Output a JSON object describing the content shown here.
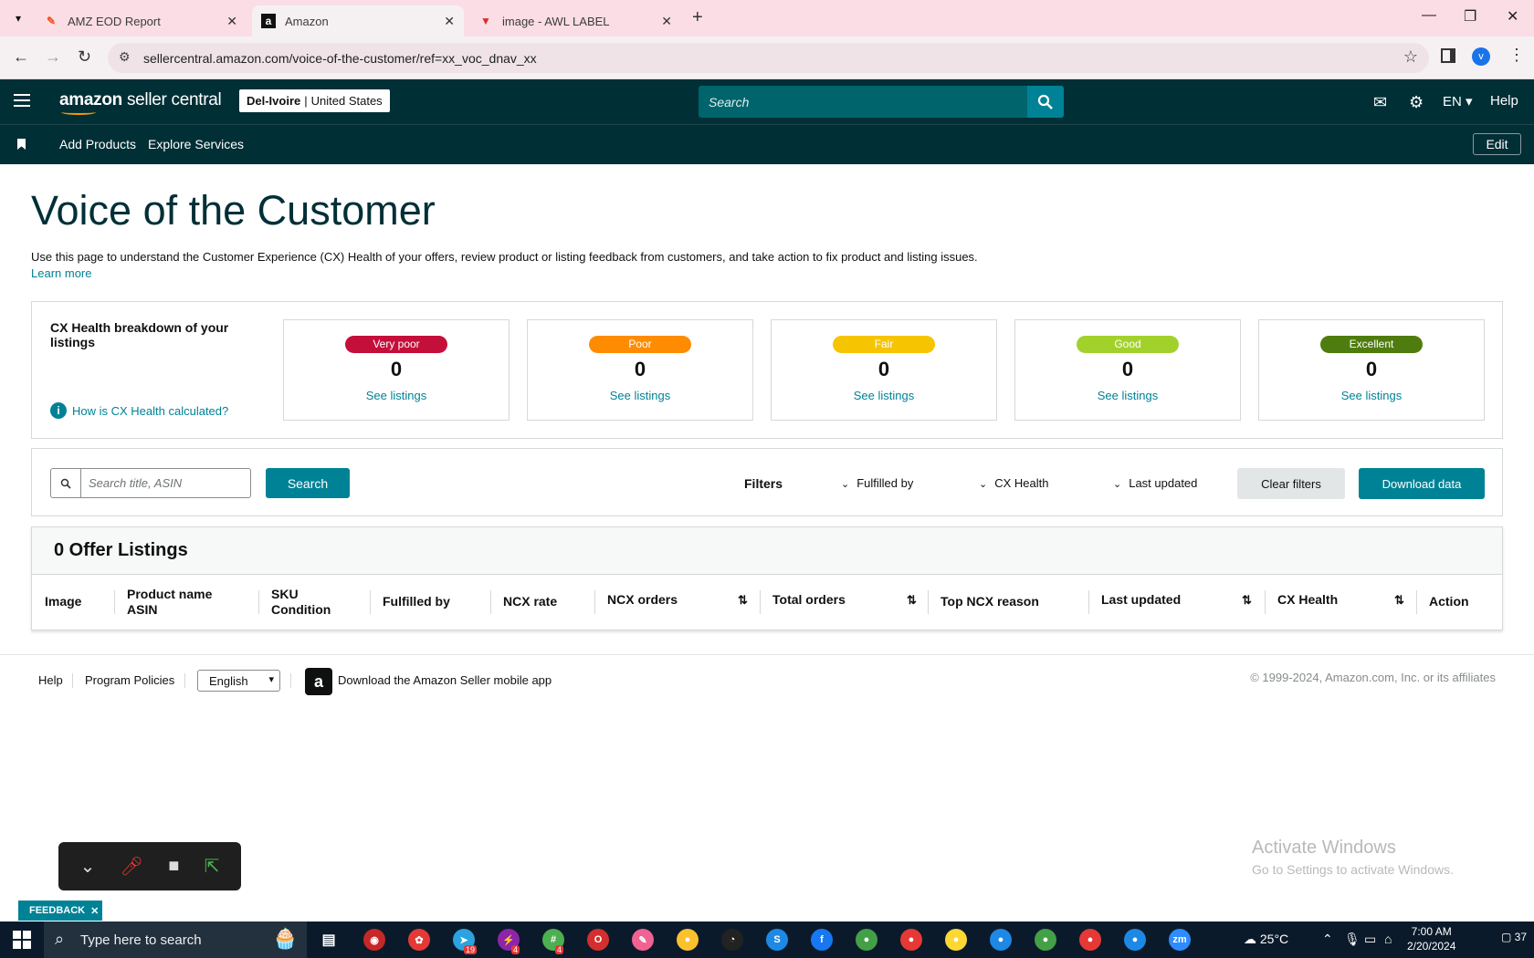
{
  "browser": {
    "tabs": [
      {
        "title": "AMZ EOD Report",
        "favicon": "apps-script-icon"
      },
      {
        "title": "Amazon",
        "favicon": "amazon-icon"
      },
      {
        "title": "image - AWL LABEL",
        "favicon": "image-icon"
      }
    ],
    "url": "sellercentral.amazon.com/voice-of-the-customer/ref=xx_voc_dnav_xx",
    "profile_initial": "v"
  },
  "header": {
    "logo_main": "amazon",
    "logo_suffix": "seller central",
    "store_name": "Del-Ivoire",
    "store_region": "United States",
    "search_placeholder": "Search",
    "language": "EN",
    "help": "Help"
  },
  "nav": {
    "links": [
      "Add Products",
      "Explore Services"
    ],
    "edit": "Edit"
  },
  "page": {
    "title": "Voice of the Customer",
    "intro": "Use this page to understand the Customer Experience (CX) Health of your offers, review product or listing feedback from customers, and take action to fix product and listing issues.",
    "learn_more": "Learn more"
  },
  "cx_health": {
    "title": "CX Health breakdown of your listings",
    "how_link": "How is CX Health calculated?",
    "cards": [
      {
        "label": "Very poor",
        "count": "0",
        "link": "See listings",
        "color": "#c40f3a"
      },
      {
        "label": "Poor",
        "count": "0",
        "link": "See listings",
        "color": "#ff8c00"
      },
      {
        "label": "Fair",
        "count": "0",
        "link": "See listings",
        "color": "#f6c400"
      },
      {
        "label": "Good",
        "count": "0",
        "link": "See listings",
        "color": "#a3d12c"
      },
      {
        "label": "Excellent",
        "count": "0",
        "link": "See listings",
        "color": "#4f7c0e"
      }
    ]
  },
  "filters": {
    "search_placeholder": "Search title, ASIN",
    "search_button": "Search",
    "label": "Filters",
    "dropdowns": [
      "Fulfilled by",
      "CX Health",
      "Last updated"
    ],
    "clear": "Clear filters",
    "download": "Download data"
  },
  "listings": {
    "title": "0 Offer Listings",
    "columns": [
      {
        "line1": "Image",
        "line2": ""
      },
      {
        "line1": "Product name",
        "line2": "ASIN"
      },
      {
        "line1": "SKU",
        "line2": "Condition"
      },
      {
        "line1": "Fulfilled by",
        "line2": ""
      },
      {
        "line1": "NCX rate",
        "line2": ""
      },
      {
        "line1": "NCX orders",
        "line2": ""
      },
      {
        "line1": "Total orders",
        "line2": ""
      },
      {
        "line1": "Top NCX reason",
        "line2": ""
      },
      {
        "line1": "Last updated",
        "line2": ""
      },
      {
        "line1": "CX Health",
        "line2": ""
      },
      {
        "line1": "Action",
        "line2": ""
      }
    ]
  },
  "footer": {
    "help": "Help",
    "policies": "Program Policies",
    "language": "English",
    "app_link": "Download the Amazon Seller mobile app",
    "copyright": "© 1999-2024, Amazon.com, Inc. or its affiliates"
  },
  "overlay": {
    "activate_title": "Activate Windows",
    "activate_sub": "Go to Settings to activate Windows.",
    "feedback": "FEEDBACK"
  },
  "taskbar": {
    "search_placeholder": "Type here to search",
    "temperature": "25°C",
    "time": "7:00 AM",
    "date": "2/20/2024",
    "notifications": "37",
    "badges": [
      "19",
      "4",
      "4"
    ]
  }
}
